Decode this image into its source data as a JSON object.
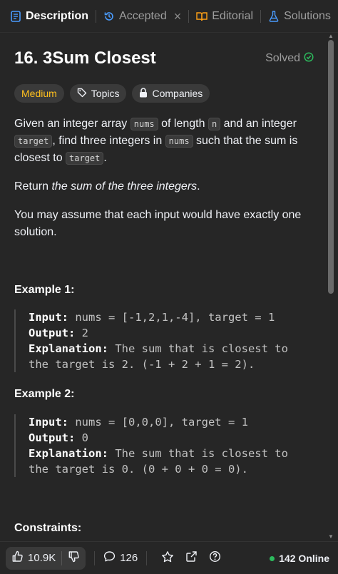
{
  "tabs": [
    {
      "label": "Description",
      "icon": "document-icon",
      "active": true
    },
    {
      "label": "Accepted",
      "icon": "history-icon"
    },
    {
      "label": "Editorial",
      "icon": "book-icon"
    },
    {
      "label": "Solutions",
      "icon": "flask-icon"
    }
  ],
  "problem": {
    "title": "16. 3Sum Closest",
    "status": "Solved",
    "tags": {
      "difficulty": "Medium",
      "topics": "Topics",
      "companies": "Companies"
    },
    "desc": {
      "p1a": "Given an integer array ",
      "c_nums": "nums",
      "p1b": " of length ",
      "c_n": "n",
      "p1c": " and an integer ",
      "c_target": "target",
      "p1d": ", find three integers in ",
      "p1e": " such that the sum is closest to ",
      "p1f": ".",
      "p2a": "Return ",
      "p2em": "the sum of the three integers",
      "p2b": ".",
      "p3": "You may assume that each input would have exactly one solution."
    },
    "examples": [
      {
        "title": "Example 1:",
        "input_label": "Input:",
        "input": " nums = [-1,2,1,-4], target = 1",
        "output_label": "Output:",
        "output": " 2",
        "expl_label": "Explanation:",
        "expl": " The sum that is closest to the target is 2. (-1 + 2 + 1 = 2)."
      },
      {
        "title": "Example 2:",
        "input_label": "Input:",
        "input": " nums = [0,0,0], target = 1",
        "output_label": "Output:",
        "output": " 0",
        "expl_label": "Explanation:",
        "expl": " The sum that is closest to the target is 0. (0 + 0 + 0 = 0)."
      }
    ],
    "constraints_title": "Constraints:"
  },
  "bottom": {
    "likes": "10.9K",
    "comments": "126",
    "online": "142 Online"
  },
  "colors": {
    "accent_medium": "#ffc01e",
    "solved": "#2cbb5d",
    "online_dot": "#2cbb5d"
  }
}
